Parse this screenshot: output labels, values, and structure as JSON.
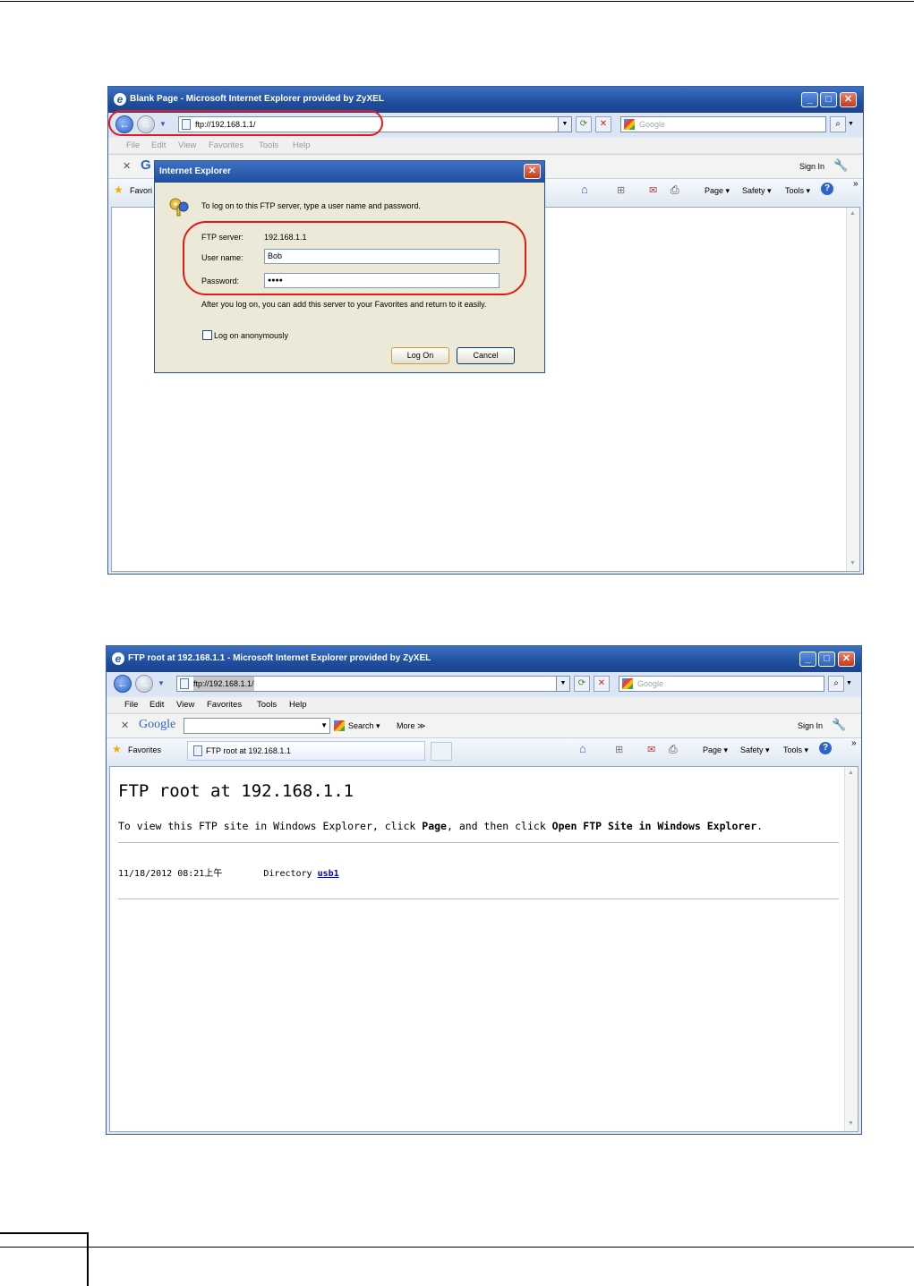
{
  "window1": {
    "title": "Blank Page - Microsoft Internet Explorer provided by ZyXEL",
    "address": "ftp://192.168.1.1/",
    "search_placeholder": "Google",
    "menu": [
      "File",
      "Edit",
      "View",
      "Favorites",
      "Tools",
      "Help"
    ],
    "sign_in": "Sign In",
    "favorites_label": "Favori",
    "toolbar_right": {
      "page": "Page ▾",
      "safety": "Safety ▾",
      "tools": "Tools ▾"
    }
  },
  "dialog": {
    "title": "Internet Explorer",
    "intro": "To log on to this FTP server, type a user name and password.",
    "ftp_server_label": "FTP server:",
    "ftp_server_value": "192.168.1.1",
    "user_label": "User name:",
    "user_value": "Bob",
    "password_label": "Password:",
    "password_value": "●●●●",
    "after_note": "After you log on, you can add this server to your Favorites and return to it easily.",
    "anon_label": "Log on anonymously",
    "logon_button": "Log On",
    "cancel_button": "Cancel"
  },
  "window2": {
    "title": "FTP root at 192.168.1.1 - Microsoft Internet Explorer provided by ZyXEL",
    "address": "ftp://192.168.1.1/",
    "search_placeholder": "Google",
    "menu": [
      "File",
      "Edit",
      "View",
      "Favorites",
      "Tools",
      "Help"
    ],
    "google_logo": "Google",
    "search_button": "Search ▾",
    "more_button": "More ≫",
    "sign_in": "Sign In",
    "favorites_label": "Favorites",
    "tab_label": "FTP root at 192.168.1.1",
    "toolbar_right": {
      "page": "Page ▾",
      "safety": "Safety ▾",
      "tools": "Tools ▾"
    },
    "page": {
      "heading": "FTP root at 192.168.1.1",
      "hint_prefix": "To view this FTP site in Windows Explorer, click ",
      "hint_page": "Page",
      "hint_mid": ", and then click ",
      "hint_open": "Open FTP Site in Windows Explorer",
      "hint_end": ".",
      "entry_date": "11/18/2012 08:21上午",
      "entry_type": "Directory",
      "entry_name": "usb1"
    }
  }
}
